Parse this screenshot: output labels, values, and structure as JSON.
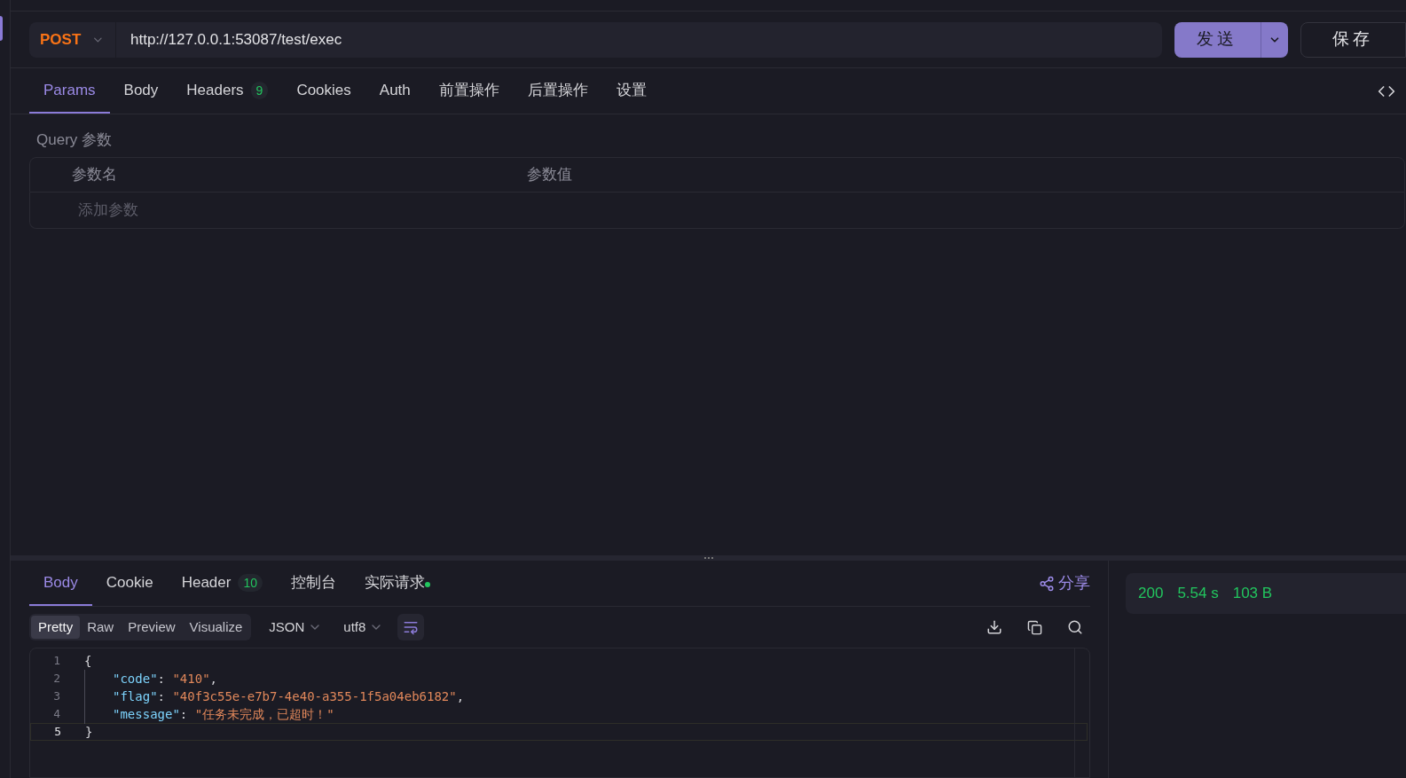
{
  "request": {
    "method": "POST",
    "url": "http://127.0.0.1:53087/test/exec",
    "send_label": "发送",
    "save_label": "保存"
  },
  "request_tabs": [
    {
      "label": "Params",
      "selected": true
    },
    {
      "label": "Body",
      "selected": false
    },
    {
      "label": "Headers",
      "count": "9",
      "selected": false
    },
    {
      "label": "Cookies",
      "selected": false
    },
    {
      "label": "Auth",
      "selected": false
    },
    {
      "label": "前置操作",
      "selected": false
    },
    {
      "label": "后置操作",
      "selected": false
    },
    {
      "label": "设置",
      "selected": false
    }
  ],
  "query": {
    "title": "Query 参数",
    "columns": [
      "参数名",
      "参数值"
    ],
    "add_placeholder": "添加参数"
  },
  "response_tabs": [
    {
      "label": "Body",
      "selected": true
    },
    {
      "label": "Cookie",
      "selected": false
    },
    {
      "label": "Header",
      "count": "10",
      "selected": false
    },
    {
      "label": "控制台",
      "selected": false
    },
    {
      "label": "实际请求",
      "dot": true,
      "selected": false
    }
  ],
  "share_label": "分享",
  "view_modes": [
    {
      "label": "Pretty",
      "selected": true
    },
    {
      "label": "Raw",
      "selected": false
    },
    {
      "label": "Preview",
      "selected": false
    },
    {
      "label": "Visualize",
      "selected": false
    }
  ],
  "format": "JSON",
  "encoding": "utf8",
  "code_lines": [
    {
      "number": "1",
      "current": false,
      "tokens": [
        {
          "kind": "punct",
          "text": "{"
        }
      ]
    },
    {
      "number": "2",
      "current": false,
      "tokens": [
        {
          "kind": "key",
          "text": "\"code\""
        },
        {
          "kind": "punct",
          "text": ": "
        },
        {
          "kind": "string",
          "text": "\"410\""
        },
        {
          "kind": "punct",
          "text": ","
        }
      ]
    },
    {
      "number": "3",
      "current": false,
      "tokens": [
        {
          "kind": "key",
          "text": "\"flag\""
        },
        {
          "kind": "punct",
          "text": ": "
        },
        {
          "kind": "string",
          "text": "\"40f3c55e-e7b7-4e40-a355-1f5a04eb6182\""
        },
        {
          "kind": "punct",
          "text": ","
        }
      ]
    },
    {
      "number": "4",
      "current": false,
      "tokens": [
        {
          "kind": "key",
          "text": "\"message\""
        },
        {
          "kind": "punct",
          "text": ": "
        },
        {
          "kind": "string",
          "text": "\"任务未完成，已超时！\""
        }
      ]
    },
    {
      "number": "5",
      "current": true,
      "tokens": [
        {
          "kind": "punct",
          "text": "}"
        }
      ]
    }
  ],
  "status": {
    "code": "200",
    "time": "5.54 s",
    "size": "103 B"
  }
}
